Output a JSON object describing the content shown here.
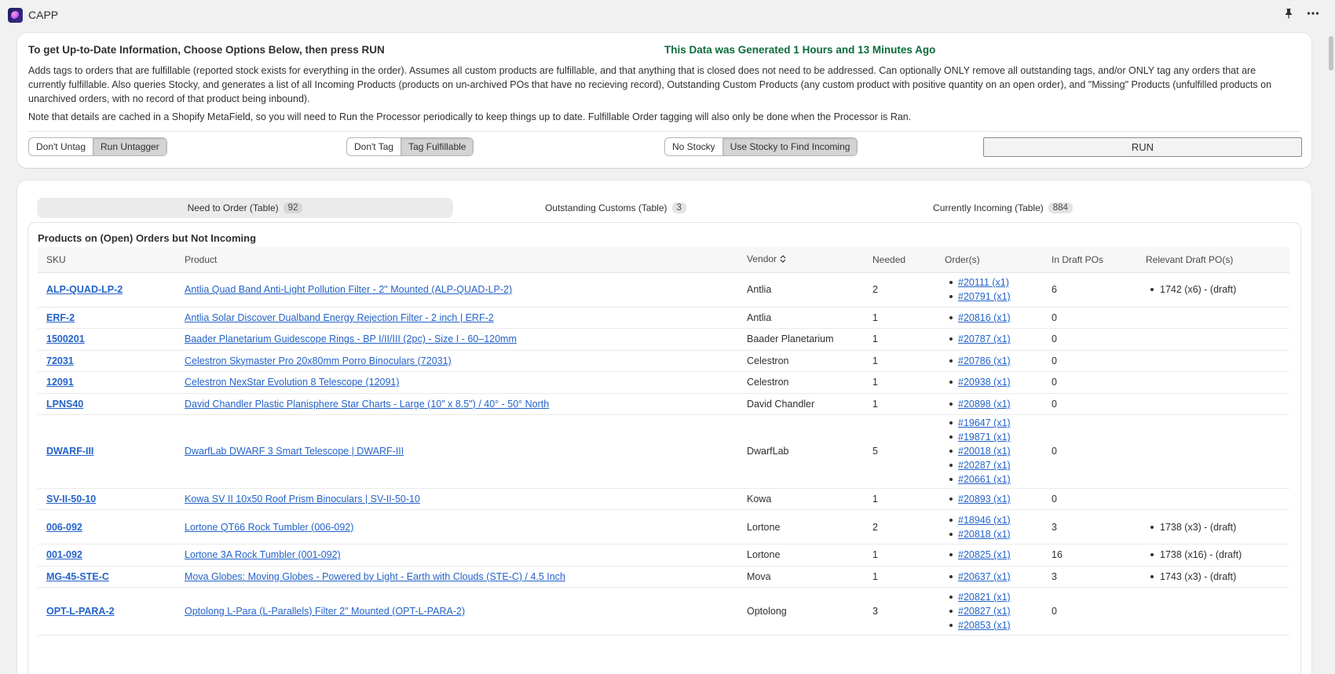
{
  "app": {
    "title": "CAPP"
  },
  "controls": {
    "heading": "To get Up-to-Date Information, Choose Options Below, then press RUN",
    "generated": "This Data was Generated 1 Hours and 13 Minutes Ago",
    "description": "Adds tags to orders that are fulfillable (reported stock exists for everything in the order). Assumes all custom products are fulfillable, and that anything that is closed does not need to be addressed. Can optionally ONLY remove all outstanding tags, and/or ONLY tag any orders that are currently fulfillable. Also queries Stocky, and generates a list of all Incoming Products (products on un-archived POs that have no recieving record), Outstanding Custom Products (any custom product with positive quantity on an open order), and \"Missing\" Products (unfulfilled products on unarchived orders, with no record of that product being inbound).",
    "note": "Note that details are cached in a Shopify MetaField, so you will need to Run the Processor periodically to keep things up to date. Fulfillable Order tagging will also only be done when the Processor is Ran.",
    "untag": {
      "off": "Don't Untag",
      "on": "Run Untagger"
    },
    "tag": {
      "off": "Don't Tag",
      "on": "Tag Fulfillable"
    },
    "stocky": {
      "off": "No Stocky",
      "on": "Use Stocky to Find Incoming"
    },
    "run_label": "RUN"
  },
  "tabs": [
    {
      "label": "Need to Order (Table)",
      "count": "92"
    },
    {
      "label": "Outstanding Customs (Table)",
      "count": "3"
    },
    {
      "label": "Currently Incoming (Table)",
      "count": "884"
    }
  ],
  "table": {
    "title": "Products on (Open) Orders but Not Incoming",
    "columns": [
      "SKU",
      "Product",
      "Vendor",
      "Needed",
      "Order(s)",
      "In Draft POs",
      "Relevant Draft PO(s)"
    ],
    "rows": [
      {
        "sku": "ALP-QUAD-LP-2",
        "product": "Antlia Quad Band Anti-Light Pollution Filter - 2\" Mounted (ALP-QUAD-LP-2)",
        "vendor": "Antlia",
        "needed": "2",
        "orders": [
          "#20111 (x1)",
          "#20791 (x1)"
        ],
        "in_draft": "6",
        "drafts": [
          "1742 (x6) - (draft)"
        ]
      },
      {
        "sku": "ERF-2",
        "product": "Antlia Solar Discover Dualband Energy Rejection Filter - 2 inch | ERF-2",
        "vendor": "Antlia",
        "needed": "1",
        "orders": [
          "#20816 (x1)"
        ],
        "in_draft": "0",
        "drafts": []
      },
      {
        "sku": "1500201",
        "product": "Baader Planetarium Guidescope Rings - BP I/II/III (2pc) - Size I - 60–120mm",
        "vendor": "Baader Planetarium",
        "needed": "1",
        "orders": [
          "#20787 (x1)"
        ],
        "in_draft": "0",
        "drafts": []
      },
      {
        "sku": "72031",
        "product": "Celestron Skymaster Pro 20x80mm Porro Binoculars (72031)",
        "vendor": "Celestron",
        "needed": "1",
        "orders": [
          "#20786 (x1)"
        ],
        "in_draft": "0",
        "drafts": []
      },
      {
        "sku": "12091",
        "product": "Celestron NexStar Evolution 8 Telescope (12091)",
        "vendor": "Celestron",
        "needed": "1",
        "orders": [
          "#20938 (x1)"
        ],
        "in_draft": "0",
        "drafts": []
      },
      {
        "sku": "LPNS40",
        "product": "David Chandler Plastic Planisphere Star Charts - Large (10\" x 8.5\") / 40° - 50° North",
        "vendor": "David Chandler",
        "needed": "1",
        "orders": [
          "#20898 (x1)"
        ],
        "in_draft": "0",
        "drafts": []
      },
      {
        "sku": "DWARF-III",
        "product": "DwarfLab DWARF 3 Smart Telescope | DWARF-III",
        "vendor": "DwarfLab",
        "needed": "5",
        "orders": [
          "#19647 (x1)",
          "#19871 (x1)",
          "#20018 (x1)",
          "#20287 (x1)",
          "#20661 (x1)"
        ],
        "in_draft": "0",
        "drafts": []
      },
      {
        "sku": "SV-II-50-10",
        "product": "Kowa SV II 10x50 Roof Prism Binoculars | SV-II-50-10",
        "vendor": "Kowa",
        "needed": "1",
        "orders": [
          "#20893 (x1)"
        ],
        "in_draft": "0",
        "drafts": []
      },
      {
        "sku": "006-092",
        "product": "Lortone QT66 Rock Tumbler (006-092)",
        "vendor": "Lortone",
        "needed": "2",
        "orders": [
          "#18946 (x1)",
          "#20818 (x1)"
        ],
        "in_draft": "3",
        "drafts": [
          "1738 (x3) - (draft)"
        ]
      },
      {
        "sku": "001-092",
        "product": "Lortone 3A Rock Tumbler (001-092)",
        "vendor": "Lortone",
        "needed": "1",
        "orders": [
          "#20825 (x1)"
        ],
        "in_draft": "16",
        "drafts": [
          "1738 (x16) - (draft)"
        ]
      },
      {
        "sku": "MG-45-STE-C",
        "product": "Mova Globes: Moving Globes - Powered by Light - Earth with Clouds (STE-C) / 4.5 Inch",
        "vendor": "Mova",
        "needed": "1",
        "orders": [
          "#20637 (x1)"
        ],
        "in_draft": "3",
        "drafts": [
          "1743 (x3) - (draft)"
        ]
      },
      {
        "sku": "OPT-L-PARA-2",
        "product": "Optolong L-Para (L-Parallels) Filter 2\" Mounted (OPT-L-PARA-2)",
        "vendor": "Optolong",
        "needed": "3",
        "orders": [
          "#20821 (x1)",
          "#20827 (x1)",
          "#20853 (x1)"
        ],
        "in_draft": "0",
        "drafts": []
      }
    ]
  }
}
